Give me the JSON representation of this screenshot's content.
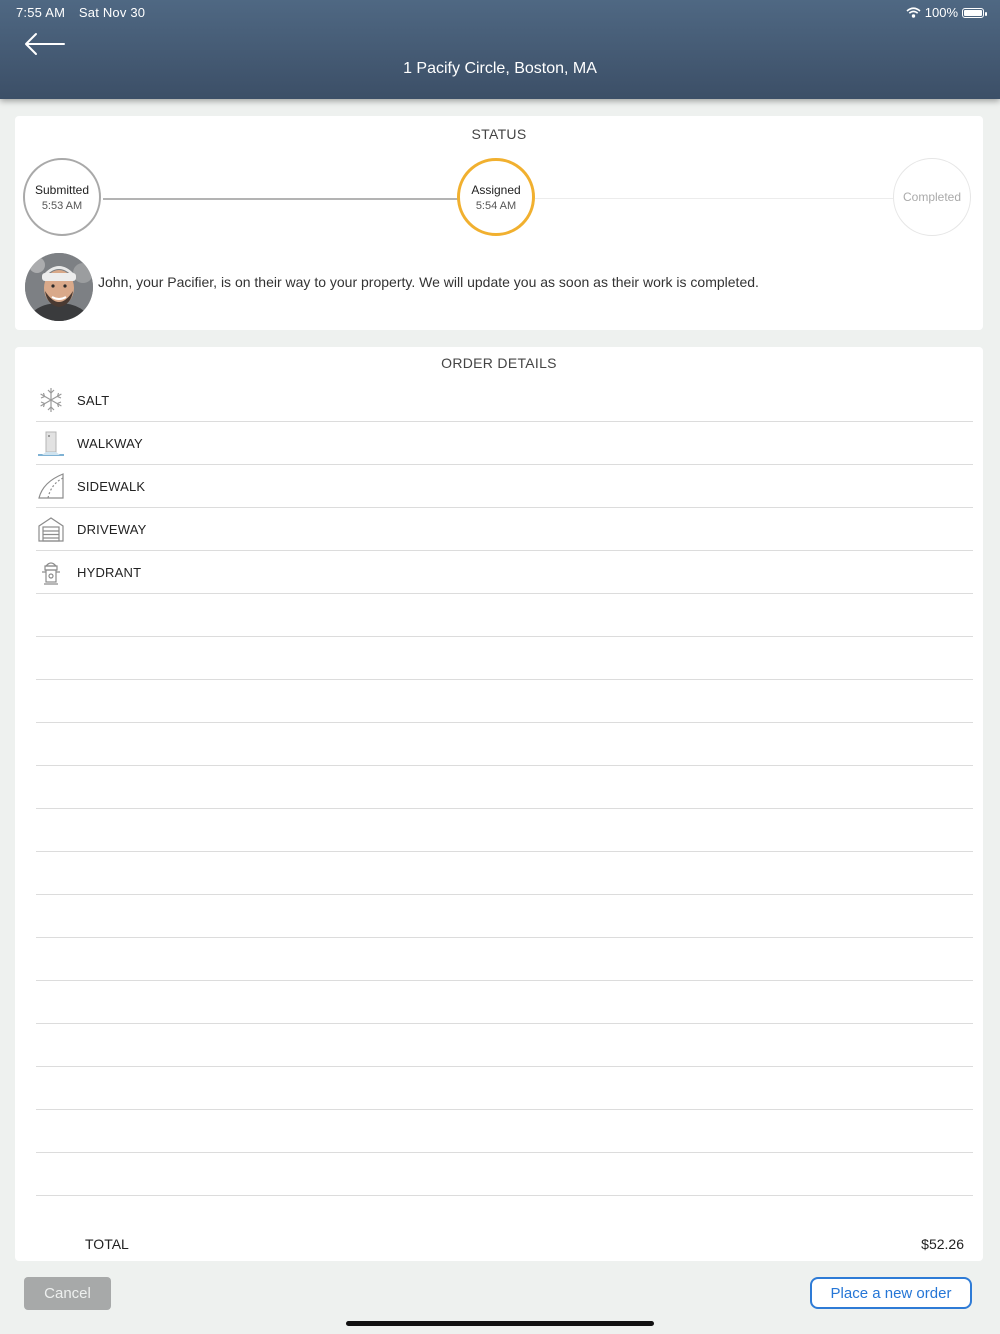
{
  "status_bar": {
    "time": "7:55 AM",
    "date": "Sat Nov 30",
    "battery": "100%",
    "icons": [
      "wifi-icon",
      "battery-icon"
    ]
  },
  "header": {
    "title": "1 Pacify Circle, Boston, MA",
    "back_icon": "back-arrow-icon"
  },
  "status": {
    "title": "STATUS",
    "steps": [
      {
        "name": "Submitted",
        "time": "5:53 AM",
        "state": "done"
      },
      {
        "name": "Assigned",
        "time": "5:54 AM",
        "state": "current"
      },
      {
        "name": "Completed",
        "time": "",
        "state": "pending"
      }
    ],
    "message": "John, your Pacifier, is on their way to your property. We will update you as soon as their work is completed.",
    "colors": {
      "current": "#f1b02f",
      "done": "#a9a9a9",
      "pending": "#e6e6e6"
    }
  },
  "order": {
    "title": "ORDER DETAILS",
    "items": [
      {
        "label": "SALT",
        "icon": "snowflake-icon"
      },
      {
        "label": "WALKWAY",
        "icon": "walkway-icon"
      },
      {
        "label": "SIDEWALK",
        "icon": "sidewalk-icon"
      },
      {
        "label": "DRIVEWAY",
        "icon": "garage-icon"
      },
      {
        "label": "HYDRANT",
        "icon": "hydrant-icon"
      }
    ],
    "total_label": "TOTAL",
    "total_value": "$52.26"
  },
  "actions": {
    "cancel": "Cancel",
    "new_order": "Place a new order"
  },
  "colors": {
    "header": "#4a627d",
    "accent": "#2e7bd6",
    "background": "#eef1ef"
  }
}
